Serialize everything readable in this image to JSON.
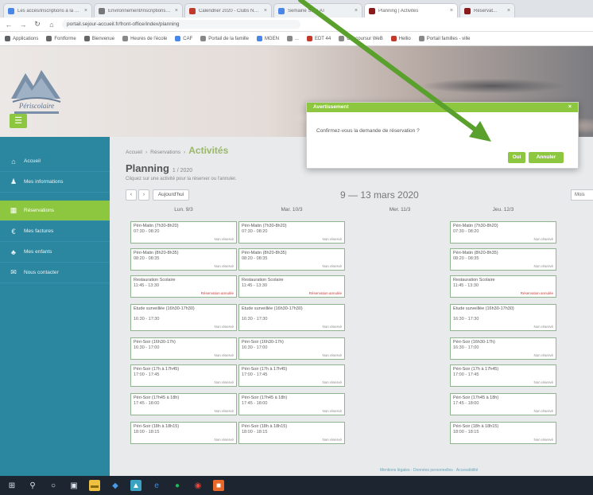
{
  "browser": {
    "tabs": [
      {
        "label": "Les accès/inscriptions à la clé...",
        "color": "#4a86e8"
      },
      {
        "label": "Environnement/Inscriptions acc...",
        "color": "#777777"
      },
      {
        "label": "Calendrier 2020 - Clubs Nautiques",
        "color": "#c0392b"
      },
      {
        "label": "Semaine Suivi AT",
        "color": "#4a86e8"
      },
      {
        "label": "Planning | Activités",
        "color": "#8b1a1a"
      },
      {
        "label": "Réservat...",
        "color": "#8b1a1a"
      }
    ],
    "url": "portail.sejour-accueil.fr/front-office/index/planning",
    "bookmarks": [
      {
        "label": "Applications",
        "color": "#5f6368"
      },
      {
        "label": "Fontforme",
        "color": "#666666"
      },
      {
        "label": "Bienvenue",
        "color": "#666666"
      },
      {
        "label": "Heures de l'école",
        "color": "#888888"
      },
      {
        "label": "CAF",
        "color": "#4a86e8"
      },
      {
        "label": "Portail de la famille",
        "color": "#888888"
      },
      {
        "label": "MGEN",
        "color": "#4a86e8"
      },
      {
        "label": "...",
        "color": "#888888"
      },
      {
        "label": "EDT 44",
        "color": "#c0392b"
      },
      {
        "label": "Concoursur WeB",
        "color": "#888888"
      },
      {
        "label": "Hellio",
        "color": "#c0392b"
      },
      {
        "label": "Portail familles - ville",
        "color": "#888888"
      }
    ]
  },
  "banner": {
    "logo_text": "Périscolaire",
    "menu_icon": "hamburger-icon"
  },
  "sidebar": {
    "items": [
      {
        "label": "Accueil",
        "icon": "home-icon",
        "glyph": "⌂",
        "active": false
      },
      {
        "label": "Mes informations",
        "icon": "user-icon",
        "glyph": "♟",
        "active": false
      },
      {
        "label": "Réservations",
        "icon": "calendar-icon",
        "glyph": "▦",
        "active": true
      },
      {
        "label": "Mes factures",
        "icon": "euro-icon",
        "glyph": "€",
        "active": false
      },
      {
        "label": "Mes enfants",
        "icon": "people-icon",
        "glyph": "♣",
        "active": false
      },
      {
        "label": "Nous contacter",
        "icon": "mail-icon",
        "glyph": "✉",
        "active": false
      }
    ]
  },
  "main": {
    "breadcrumb": [
      "Accueil",
      "Réservations"
    ],
    "breadcrumb_current": "Activités",
    "title": "Planning",
    "title_sub": "1 / 2020",
    "subtitle": "Cliquez sur une activité pour la réserver ou l'annuler.",
    "nav_prev": "‹",
    "nav_next": "›",
    "today_label": "Aujourd'hui",
    "week_label": "9 — 13 mars 2020",
    "view_select": "Mois",
    "days": [
      {
        "label": "Lun. 9/3"
      },
      {
        "label": "Mar. 10/3"
      },
      {
        "label": "Mer. 11/3"
      },
      {
        "label": "Jeu. 12/3"
      }
    ],
    "cards": [
      {
        "title": "Péri-Matin (7h30-8h20)",
        "time": "07:30 - 08:20",
        "status": "Non réservé",
        "red": false
      },
      {
        "title": "Péri-Matin (8h20-8h35)",
        "time": "08:20 - 08:35",
        "status": "Non réservé",
        "red": false
      },
      {
        "title": "Restauration Scolaire",
        "time": "11:45 - 13:30",
        "status": "Réservation annulée",
        "red": true
      },
      {
        "title": "Etude surveillée (16h30-17h30)",
        "time": "16:30 - 17:30",
        "status": "Non réservé",
        "red": false
      },
      {
        "title": "Péri-Soir (16h30-17h)",
        "time": "16:30 - 17:00",
        "status": "Non réservé",
        "red": false
      },
      {
        "title": "Péri-Soir (17h à 17h45)",
        "time": "17:00 - 17:45",
        "status": "Non réservé",
        "red": false
      },
      {
        "title": "Péri-Soir (17h45 à 18h)",
        "time": "17:45 - 18:00",
        "status": "Non réservé",
        "red": false
      },
      {
        "title": "Péri-Soir (18h à 18h15)",
        "time": "18:00 - 18:15",
        "status": "Non réservé",
        "red": false
      }
    ],
    "footer": "Mentions légales · Données personnelles · Accessibilité"
  },
  "modal": {
    "title": "Avertissement",
    "close": "×",
    "message": "Confirmez-vous la demande de réservation ?",
    "ok": "Oui",
    "cancel": "Annuler"
  },
  "annotation": {
    "arrow_color": "#5aa02c"
  },
  "taskbar": {
    "icons": [
      {
        "name": "windows-start-icon",
        "glyph": "⊞",
        "bg": "transparent",
        "color": "#dfe6ee"
      },
      {
        "name": "search-icon",
        "glyph": "⚲",
        "bg": "transparent",
        "color": "#dfe6ee"
      },
      {
        "name": "cortana-icon",
        "glyph": "○",
        "bg": "transparent",
        "color": "#dfe6ee"
      },
      {
        "name": "task-view-icon",
        "glyph": "▣",
        "bg": "transparent",
        "color": "#dfe6ee"
      },
      {
        "name": "file-explorer-icon",
        "glyph": "▬",
        "bg": "#f0c040",
        "color": "#8a6a10"
      },
      {
        "name": "store-icon",
        "glyph": "◆",
        "bg": "transparent",
        "color": "#4a9be8"
      },
      {
        "name": "photos-icon",
        "glyph": "▲",
        "bg": "#3aa3c4",
        "color": "#fff"
      },
      {
        "name": "edge-icon",
        "glyph": "e",
        "bg": "transparent",
        "color": "#3a8ee8"
      },
      {
        "name": "spotify-icon",
        "glyph": "●",
        "bg": "transparent",
        "color": "#1db954"
      },
      {
        "name": "chrome-icon",
        "glyph": "◉",
        "bg": "transparent",
        "color": "#e8453c"
      },
      {
        "name": "office-icon",
        "glyph": "■",
        "bg": "#e8682a",
        "color": "#fff"
      }
    ]
  }
}
